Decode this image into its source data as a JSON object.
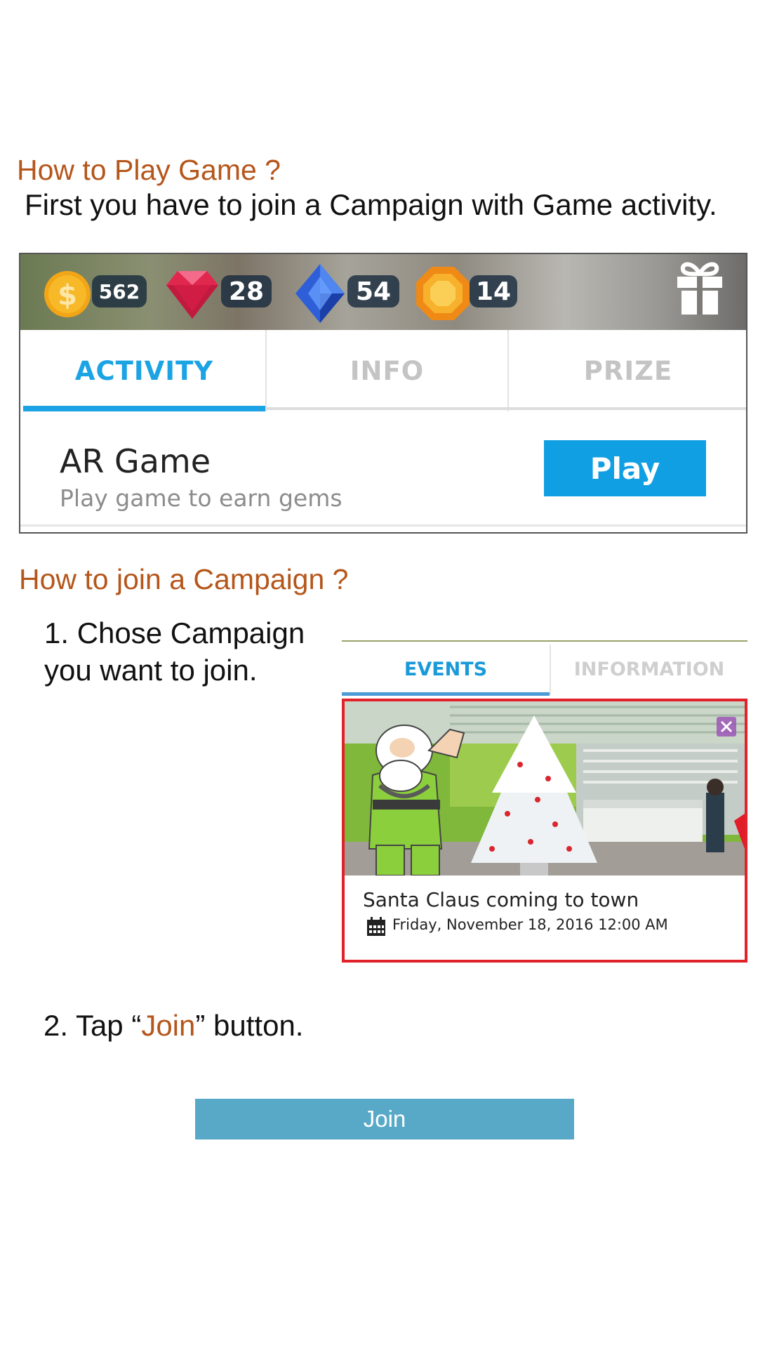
{
  "section1": {
    "heading": "How to Play Game ?",
    "intro": "First you have to join a Campaign with Game activity."
  },
  "game": {
    "resources": [
      {
        "icon": "coin-icon",
        "value": "562"
      },
      {
        "icon": "ruby-gem-icon",
        "value": "28"
      },
      {
        "icon": "sapphire-gem-icon",
        "value": "54"
      },
      {
        "icon": "amber-gem-icon",
        "value": "14"
      }
    ],
    "gift_icon": "gift-icon",
    "tabs": [
      {
        "label": "ACTIVITY",
        "active": true
      },
      {
        "label": "INFO",
        "active": false
      },
      {
        "label": "PRIZE",
        "active": false
      }
    ],
    "activity": {
      "title": "AR Game",
      "subtitle": "Play game to earn gems",
      "button": "Play"
    },
    "colors": {
      "accent": "#1ba3e4",
      "inactive_tab": "#c4c4c4",
      "play_button": "#119fe3"
    }
  },
  "section2": {
    "heading": "How to join a Campaign ?",
    "step1_line1": "1. Chose Campaign",
    "step1_line2": "you want to join.",
    "step2_prefix": "2. Tap “",
    "step2_highlight": "Join",
    "step2_suffix": "” button."
  },
  "events": {
    "tabs": [
      {
        "label": "EVENTS",
        "active": true
      },
      {
        "label": "INFORMATION",
        "active": false
      }
    ],
    "card": {
      "title": "Santa Claus coming to town",
      "date": "Friday, November 18, 2016 12:00 AM",
      "close_icon": "close-icon",
      "calendar_icon": "calendar-icon"
    },
    "colors": {
      "highlight_border": "#e2222a",
      "active_tab": "#1a9ad9"
    }
  },
  "join_button": {
    "label": "Join",
    "color": "#58a9c8"
  },
  "colors": {
    "heading": "#b5561b"
  }
}
